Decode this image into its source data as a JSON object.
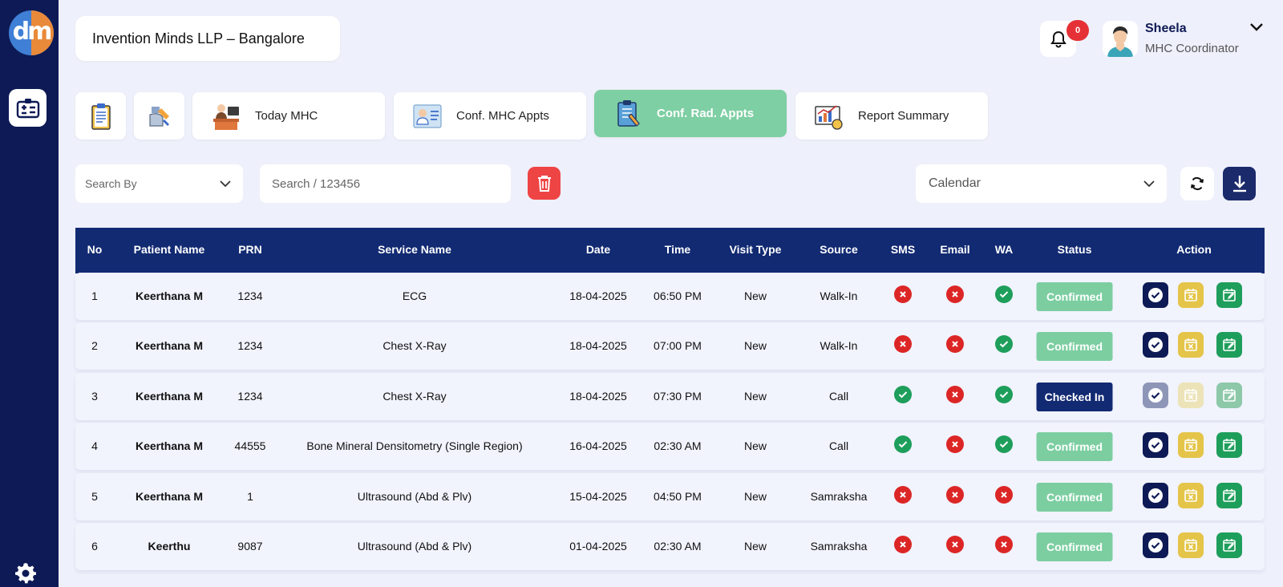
{
  "brand": {
    "logo_text": "dm"
  },
  "header": {
    "org_name": "Invention Minds LLP – Bangalore",
    "notifications_count": "0",
    "user_name": "Sheela",
    "user_role": "MHC Coordinator"
  },
  "tabs": [
    {
      "label": "",
      "icon": "clipboard-icon"
    },
    {
      "label": "",
      "icon": "xray-tools-icon"
    },
    {
      "label": "Today MHC",
      "icon": "doctor-desk-icon"
    },
    {
      "label": "Conf. MHC Appts",
      "icon": "doctor-card-icon"
    },
    {
      "label": "Conf. Rad. Appts",
      "icon": "radiology-clipboard-icon",
      "active": true
    },
    {
      "label": "Report Summary",
      "icon": "report-chart-icon"
    }
  ],
  "filters": {
    "search_by_placeholder": "Search By",
    "search_placeholder": "Search / 123456",
    "calendar_placeholder": "Calendar"
  },
  "table": {
    "columns": [
      "No",
      "Patient Name",
      "PRN",
      "Service Name",
      "Date",
      "Time",
      "Visit Type",
      "Source",
      "SMS",
      "Email",
      "WA",
      "Status",
      "Action"
    ],
    "rows": [
      {
        "no": "1",
        "patient": "Keerthana M",
        "prn": "1234",
        "service": "ECG",
        "date": "18-04-2025",
        "time": "06:50 PM",
        "visit": "New",
        "source": "Walk-In",
        "sms": false,
        "email": false,
        "wa": true,
        "status": "Confirmed"
      },
      {
        "no": "2",
        "patient": "Keerthana M",
        "prn": "1234",
        "service": "Chest X-Ray",
        "date": "18-04-2025",
        "time": "07:00 PM",
        "visit": "New",
        "source": "Walk-In",
        "sms": false,
        "email": false,
        "wa": true,
        "status": "Confirmed"
      },
      {
        "no": "3",
        "patient": "Keerthana M",
        "prn": "1234",
        "service": "Chest X-Ray",
        "date": "18-04-2025",
        "time": "07:30 PM",
        "visit": "New",
        "source": "Call",
        "sms": true,
        "email": false,
        "wa": true,
        "status": "Checked In"
      },
      {
        "no": "4",
        "patient": "Keerthana M",
        "prn": "44555",
        "service": "Bone Mineral Densitometry (Single Region)",
        "date": "16-04-2025",
        "time": "02:30 AM",
        "visit": "New",
        "source": "Call",
        "sms": true,
        "email": false,
        "wa": true,
        "status": "Confirmed"
      },
      {
        "no": "5",
        "patient": "Keerthana M",
        "prn": "1",
        "service": "Ultrasound (Abd & Plv)",
        "date": "15-04-2025",
        "time": "04:50 PM",
        "visit": "New",
        "source": "Samraksha",
        "sms": false,
        "email": false,
        "wa": false,
        "status": "Confirmed"
      },
      {
        "no": "6",
        "patient": "Keerthu",
        "prn": "9087",
        "service": "Ultrasound (Abd & Plv)",
        "date": "01-04-2025",
        "time": "02:30 AM",
        "visit": "New",
        "source": "Samraksha",
        "sms": false,
        "email": false,
        "wa": false,
        "status": "Confirmed"
      }
    ]
  },
  "colors": {
    "sidebar": "#0e1a55",
    "table_header": "#122a72",
    "active_tab": "#7ecfa3",
    "confirmed": "#7ccea1",
    "checked_in": "#122a72",
    "status_no": "#dc2626",
    "status_yes": "#1e9e5b",
    "delete": "#ef4444"
  }
}
